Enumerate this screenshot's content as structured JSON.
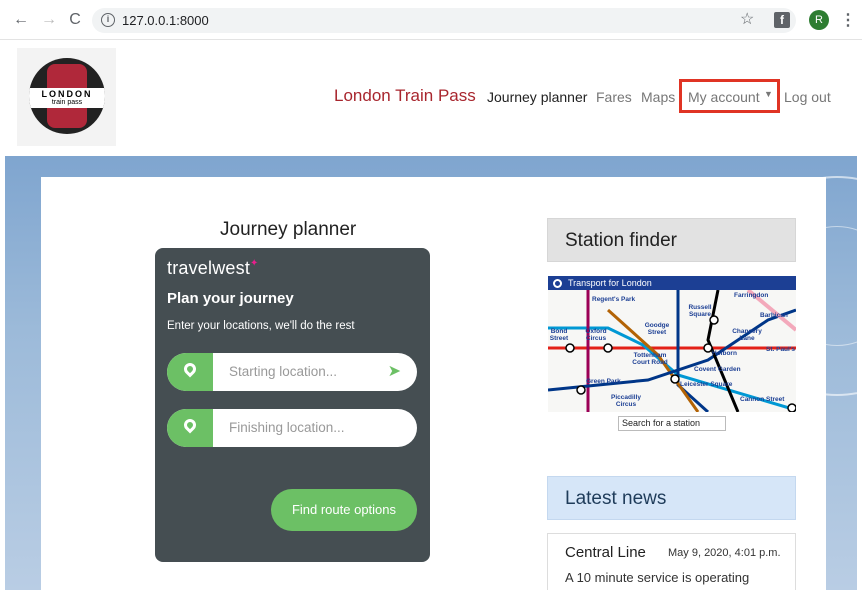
{
  "browser": {
    "url": "127.0.0.1:8000",
    "profile_initial": "R",
    "extension_letter": "f"
  },
  "header": {
    "logo_line1": "LONDON",
    "logo_line2": "train pass",
    "brand": "London Train Pass",
    "nav": {
      "journey": "Journey planner",
      "fares": "Fares",
      "maps": "Maps",
      "account": "My account",
      "logout": "Log out"
    }
  },
  "planner": {
    "title": "Journey planner",
    "brand": "travelwest",
    "heading": "Plan your journey",
    "subheading": "Enter your locations, we'll do the rest",
    "start_placeholder": "Starting location...",
    "finish_placeholder": "Finishing location...",
    "find_button": "Find route options"
  },
  "station_finder": {
    "title": "Station finder",
    "map_header": "Transport for London",
    "stations": [
      "Regent's Park",
      "Russell Square",
      "Farringdon",
      "Barbican",
      "Bond Street",
      "Oxford Circus",
      "Goodge Street",
      "Chancery Lane",
      "St. Paul's",
      "Tottenham Court Road",
      "Holborn",
      "Covent Garden",
      "Green Park",
      "Leicester Square",
      "Piccadilly Circus",
      "Cannon Street"
    ],
    "search_label": "Search for a station"
  },
  "news": {
    "title": "Latest news",
    "items": [
      {
        "headline": "Central Line",
        "date": "May 9, 2020, 4:01 p.m.",
        "body": "A 10 minute service is operating"
      }
    ]
  },
  "colors": {
    "brand_red": "#a8262e",
    "highlight_red": "#e03424",
    "planner_card": "#454e52",
    "accent_green": "#6cc065"
  }
}
